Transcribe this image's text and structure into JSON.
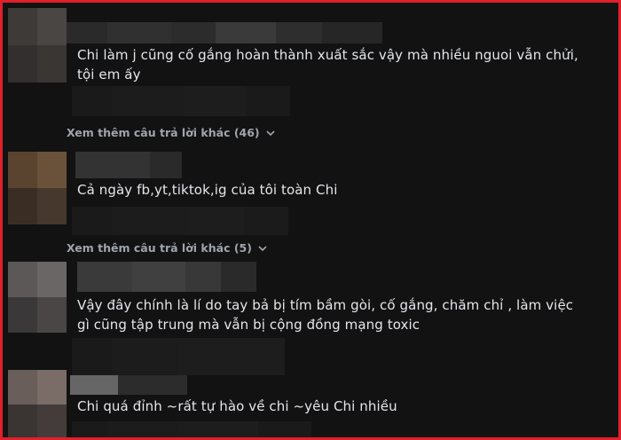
{
  "comments": [
    {
      "text": "Chi làm j cũng cố gắng hoàn thành xuất sắc vậy mà nhiều nguoi vẫn chửi, tội em ấy"
    },
    {
      "text": "Cả ngày fb,yt,tiktok,ig của tôi toàn Chi"
    },
    {
      "text": "Vậy đây chính là lí do tay bả bị tím bầm gòi, cố gắng, chăm chỉ , làm việc gì cũng tập trung mà vẫn bị cộng đồng mạng toxic"
    },
    {
      "text": "Chi quá đỉnh ~rất tự hào về chi ~yêu Chi nhiều"
    }
  ],
  "view_more": [
    {
      "label": "Xem thêm câu trả lời khác (46)",
      "icon": "chevron-down-icon"
    },
    {
      "label": "Xem thêm câu trả lời khác (5)",
      "icon": "chevron-down-icon"
    }
  ],
  "colors": {
    "frame_border": "#e0202a",
    "background": "#121212",
    "text": "#e4e6eb",
    "muted": "#a0a4aa"
  }
}
